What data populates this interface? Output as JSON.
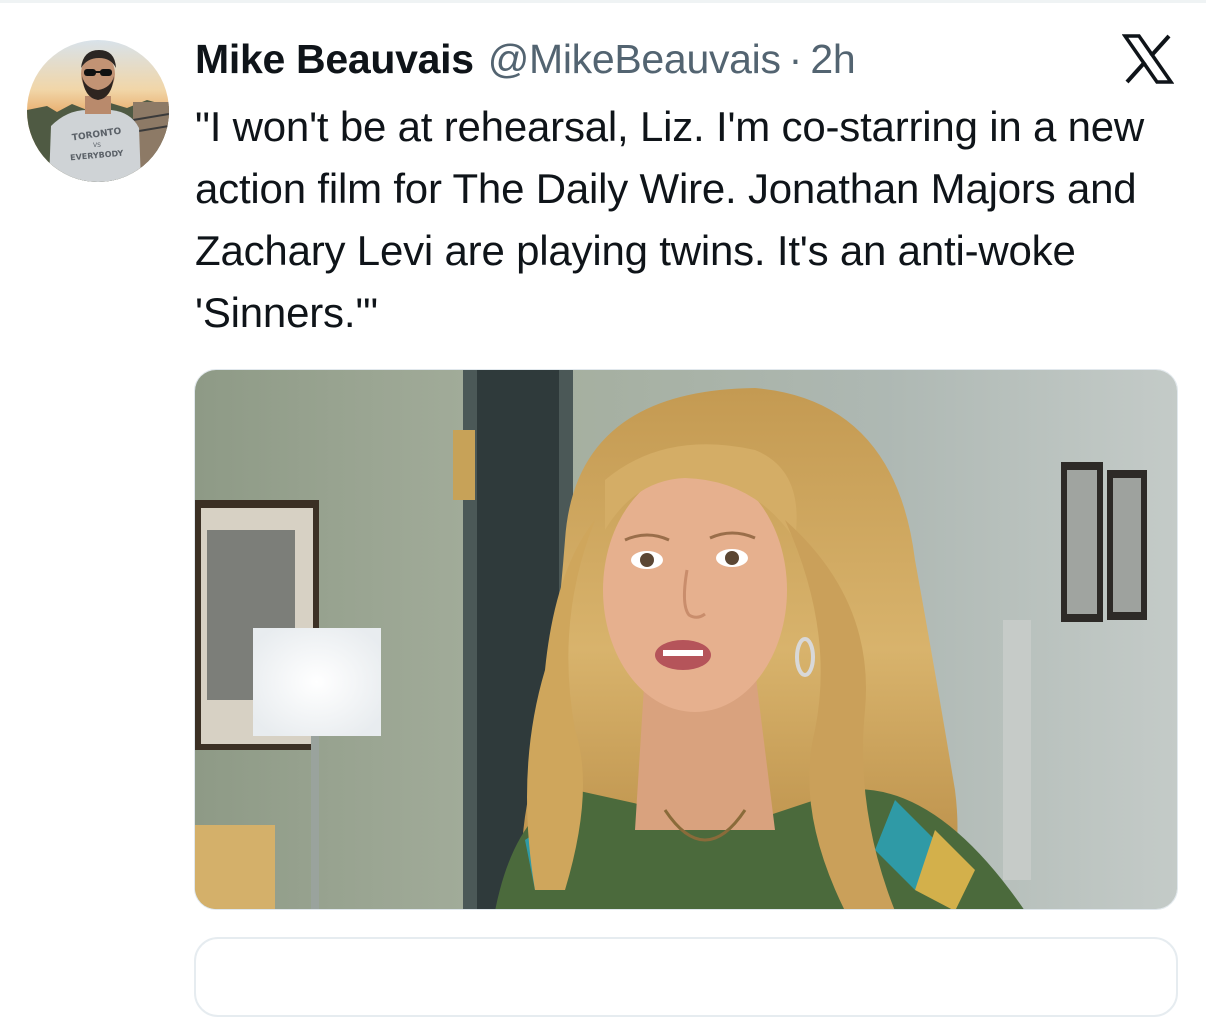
{
  "tweet": {
    "author_name": "Mike Beauvais",
    "author_handle": "@MikeBeauvais",
    "separator": "·",
    "timestamp": "2h",
    "text": "\"I won't be at rehearsal, Liz. I'm co-starring in a new action film for The Daily Wire. Jonathan Majors and Zachary Levi are playing twins. It's an anti-woke 'Sinners.'\"",
    "avatar_shirt_text": [
      "TORONTO",
      "VS",
      "EVERYBODY"
    ]
  },
  "icons": {
    "platform_logo": "x-logo-icon",
    "avatar": "profile-photo"
  },
  "colors": {
    "text_primary": "#0f1419",
    "text_secondary": "#536471",
    "border": "#e1e8ed"
  }
}
